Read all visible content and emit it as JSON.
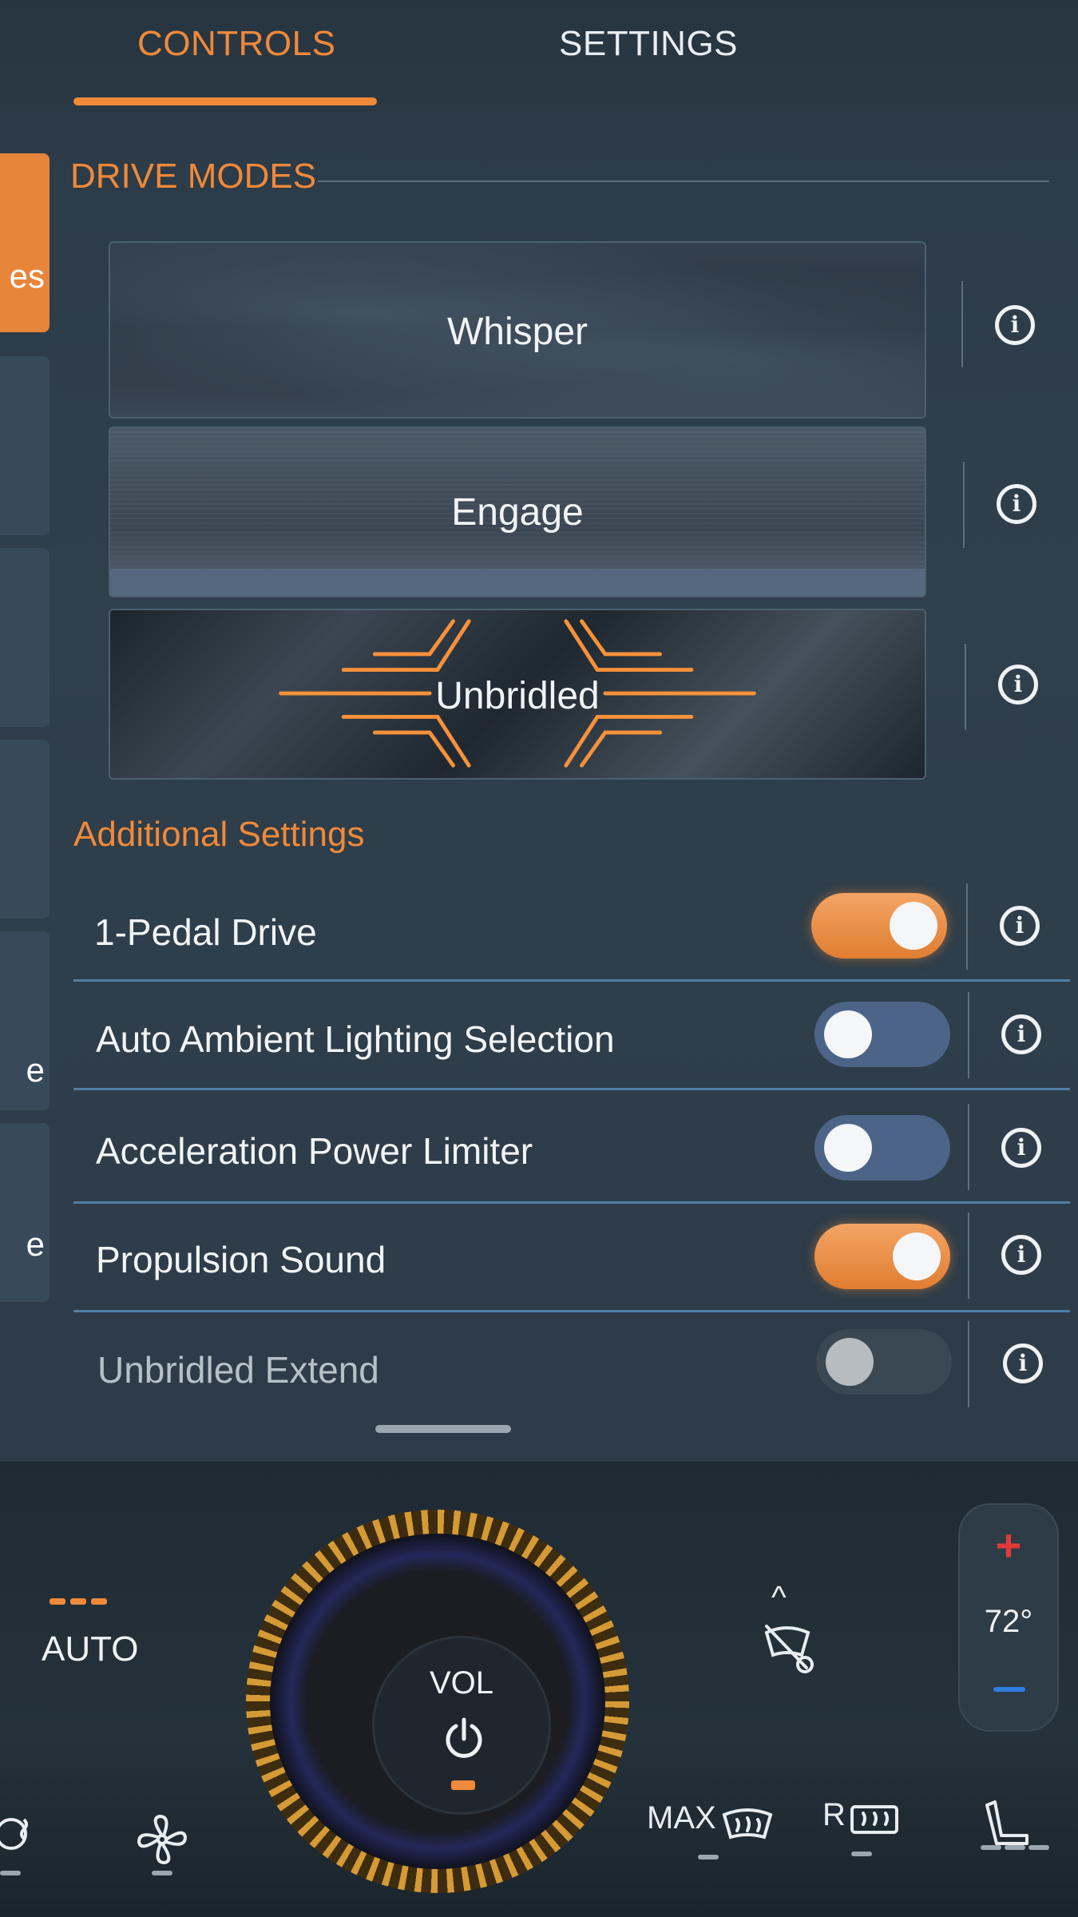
{
  "tabs": {
    "controls": "CONTROLS",
    "settings": "SETTINGS"
  },
  "left_rail": {
    "item1": "es",
    "item5": "e",
    "item6": "e"
  },
  "drive_modes": {
    "title": "DRIVE MODES",
    "modes": [
      "Whisper",
      "Engage",
      "Unbridled"
    ],
    "selected": "Engage"
  },
  "additional": {
    "title": "Additional Settings",
    "rows": [
      {
        "label": "1-Pedal Drive",
        "state": "on"
      },
      {
        "label": "Auto Ambient Lighting Selection",
        "state": "off"
      },
      {
        "label": "Acceleration Power Limiter",
        "state": "off"
      },
      {
        "label": "Propulsion Sound",
        "state": "on"
      },
      {
        "label": "Unbridled Extend",
        "state": "disabled"
      }
    ]
  },
  "info_glyph": "i",
  "climate": {
    "auto": "AUTO",
    "vol": "VOL",
    "temp": "72°",
    "max_defrost": "MAX",
    "rear_defrost": "R"
  },
  "icons": [
    "power-icon",
    "windshield-auto-icon",
    "fan-icon",
    "heated-wheel-icon",
    "seat-heat-icon"
  ],
  "colors": {
    "accent": "#f0893a",
    "toggle_off": "#4c6488",
    "temp_up": "#e23a3a",
    "temp_down": "#2f7de0"
  }
}
